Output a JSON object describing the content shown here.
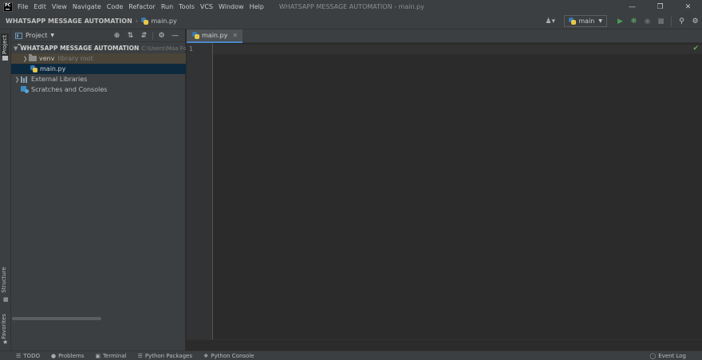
{
  "menu": {
    "items": [
      "File",
      "Edit",
      "View",
      "Navigate",
      "Code",
      "Refactor",
      "Run",
      "Tools",
      "VCS",
      "Window",
      "Help"
    ],
    "window_title": "WHATSAPP MESSAGE AUTOMATION - main.py"
  },
  "navbar": {
    "project": "WHATSAPP MESSAGE AUTOMATION",
    "separator": "›",
    "file": "main.py",
    "run_config": "main"
  },
  "tool_strip": {
    "project": "Project",
    "structure": "Structure",
    "favorites": "Favorites"
  },
  "project_panel": {
    "title": "Project",
    "root": {
      "name": "WHATSAPP MESSAGE AUTOMATION",
      "path": "C:\\Users\\Maa Fo"
    },
    "venv": {
      "name": "venv",
      "hint": "library root"
    },
    "main_file": "main.py",
    "external_libraries": "External Libraries",
    "scratches": "Scratches and Consoles"
  },
  "editor": {
    "tab_label": "main.py",
    "line_number": "1"
  },
  "bottom_bar": {
    "todo": "TODO",
    "problems": "Problems",
    "terminal": "Terminal",
    "python_packages": "Python Packages",
    "python_console": "Python Console",
    "event_log": "Event Log"
  },
  "icons": {
    "app": "pycharm-logo",
    "run": "run-icon",
    "debug": "debug-icon",
    "search": "search-icon",
    "settings": "gear-icon"
  },
  "colors": {
    "accent": "#4a88c7",
    "run_green": "#499c54",
    "selection": "#0d293e"
  }
}
